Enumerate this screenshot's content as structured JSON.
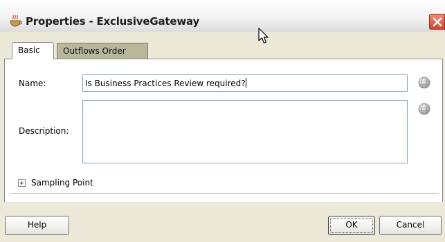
{
  "window": {
    "title": "Properties - ExclusiveGateway",
    "app_icon": "oracle-cup-icon",
    "close_icon": "close-icon"
  },
  "tabs": [
    {
      "label": "Basic",
      "active": true
    },
    {
      "label": "Outflows Order",
      "active": false
    }
  ],
  "form": {
    "name_label": "Name:",
    "name_value": "Is Business Practices Review required?",
    "description_label": "Description:",
    "description_value": "",
    "translation_icon": "globe-icon"
  },
  "sampling": {
    "label": "Sampling Point",
    "expander_icon": "expand-plus-icon"
  },
  "buttons": {
    "help": "Help",
    "ok": "OK",
    "cancel": "Cancel"
  },
  "colors": {
    "dialog_background": "#ece9d8",
    "inactive_tab": "#b8b79a",
    "close_button": "#d2452c",
    "input_border": "#7f9db9"
  }
}
